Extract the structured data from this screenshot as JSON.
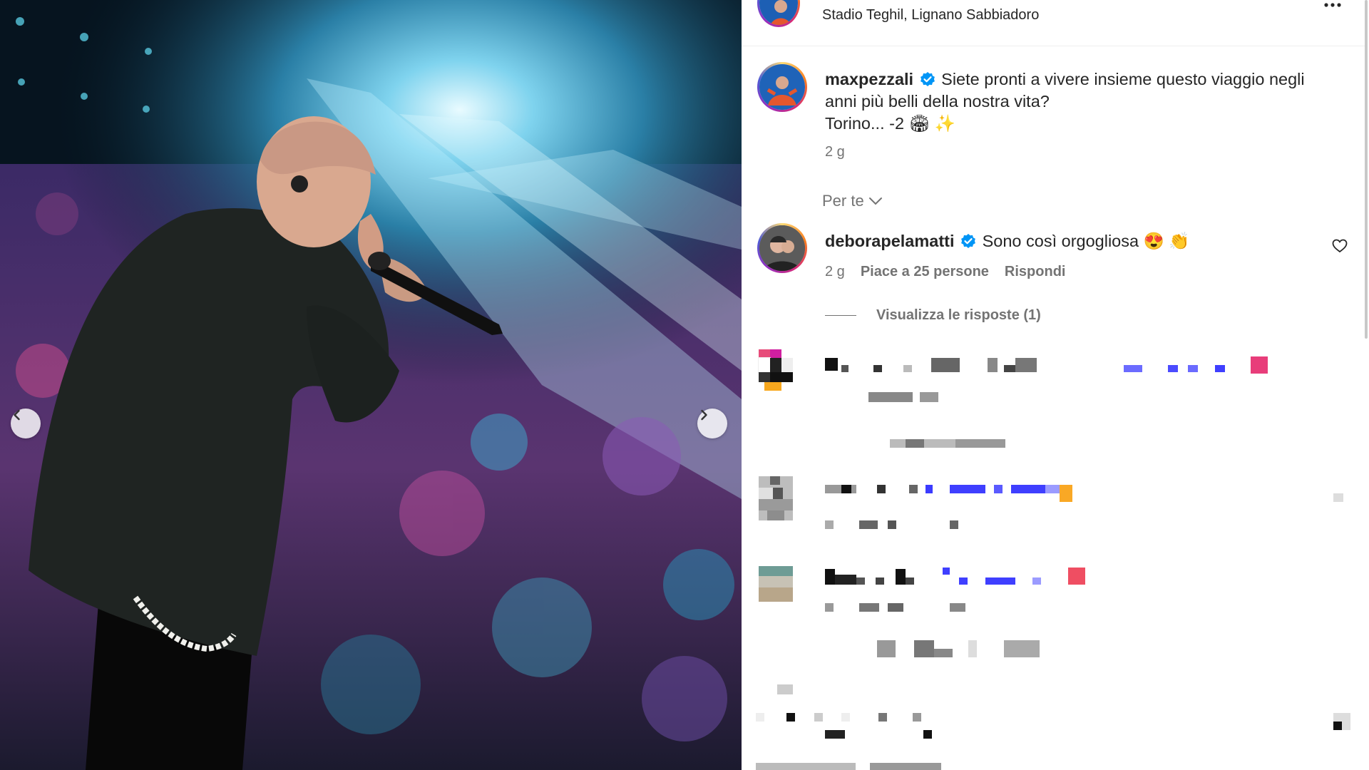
{
  "post": {
    "location": "Stadio Teghil, Lignano Sabbiadoro",
    "author": "maxpezzali",
    "caption_line1": "Siete pronti a vivere insieme questo viaggio negli",
    "caption_line2": "anni più belli della nostra vita?",
    "caption_line3": "Torino... -2 🏟 ✨",
    "age": "2 g"
  },
  "comments_filter": {
    "label": "Per te"
  },
  "comment": {
    "author": "deborapelamatti",
    "text": "Sono così orgogliosa 😍 👏",
    "age": "2 g",
    "likes": "Piace a 25 persone",
    "reply": "Rispondi",
    "view_replies": "Visualizza le risposte (1)"
  },
  "icons": {
    "more": "more-options-icon",
    "verified": "verified-badge-icon",
    "heart": "heart-icon",
    "chevron": "chevron-down-icon",
    "prev": "chevron-left-icon",
    "next": "chevron-right-icon"
  },
  "colors": {
    "verified": "#0095f6",
    "muted": "#737373"
  }
}
